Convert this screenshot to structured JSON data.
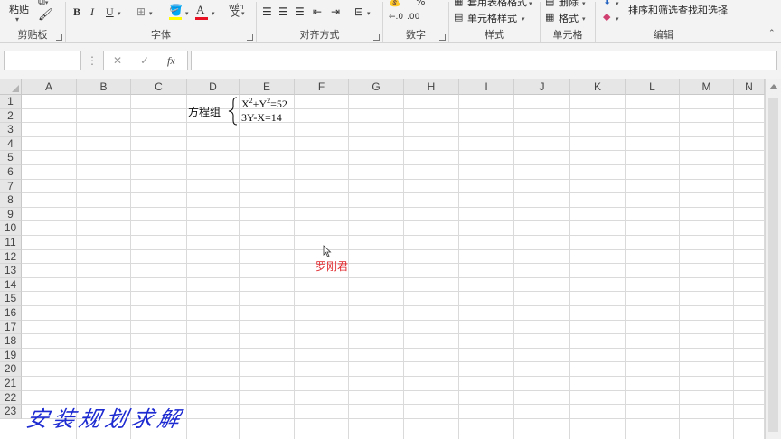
{
  "ribbon": {
    "groups": {
      "clipboard": "剪贴板",
      "font": "字体",
      "alignment": "对齐方式",
      "number": "数字",
      "styles": "样式",
      "cells": "单元格",
      "editing": "编辑"
    },
    "paste_label": "粘贴",
    "format_as_table": "套用表格格式",
    "cell_styles": "单元格样式",
    "delete_label": "删除",
    "format_label": "格式",
    "sort_filter": "排序和筛选",
    "find_select": "查找和选择",
    "bold": "B",
    "italic": "I",
    "underline": "U",
    "wen": "wén",
    "percent": "%"
  },
  "formula_bar": {
    "fx": "fx",
    "cancel": "✕",
    "confirm": "✓",
    "dots": "⋮"
  },
  "columns": [
    "A",
    "B",
    "C",
    "D",
    "E",
    "F",
    "G",
    "H",
    "I",
    "J",
    "K",
    "L",
    "M",
    "N"
  ],
  "rows": [
    "1",
    "2",
    "3",
    "4",
    "5",
    "6",
    "7",
    "8",
    "9",
    "10",
    "11",
    "12",
    "13",
    "14",
    "15",
    "16",
    "17",
    "18",
    "19",
    "20",
    "21",
    "22",
    "23"
  ],
  "sheet": {
    "equation_label": "方程组",
    "eq1": {
      "base_x": "X",
      "sup_x": "2",
      "plus": "+Y",
      "sup_y": "2",
      "rhs": "=52"
    },
    "eq2": "3Y-X=14",
    "author": "罗刚君"
  },
  "watermark": "安装规划求解",
  "colors": {
    "author": "#e0282d",
    "watermark": "#1d2bd1",
    "font_color_underline": "#e81123",
    "fill_color_underline": "#ffff00"
  }
}
